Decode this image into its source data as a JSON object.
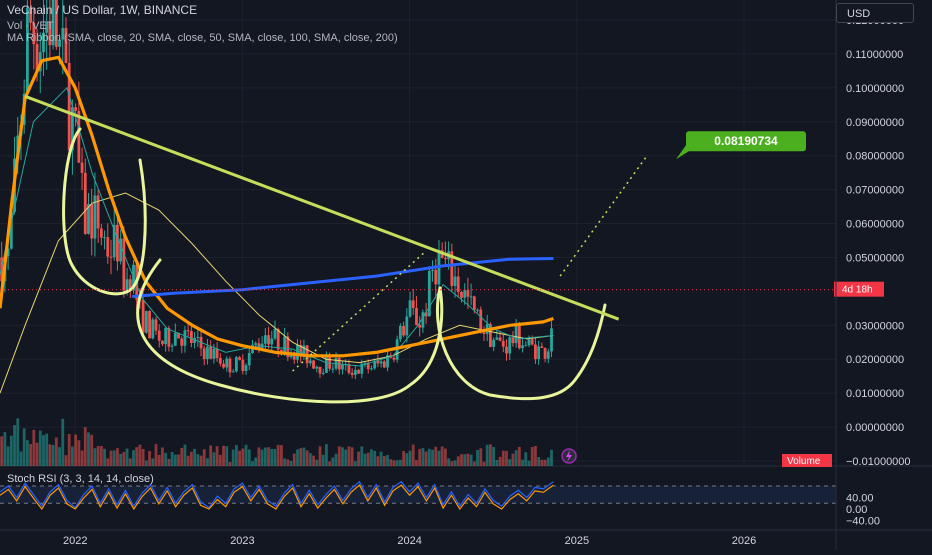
{
  "header": {
    "symbol_line": "VeChain / US Dollar, 1W, BINANCE",
    "vol_line": "Vol · VET",
    "ma_line": "MA Ribbon (SMA, close, 20, SMA, close, 50, SMA, close, 100, SMA, close, 200)"
  },
  "currency_button": "USD",
  "price_axis": {
    "labels": [
      "0.12000000",
      "0.11000000",
      "0.10000000",
      "0.09000000",
      "0.08000000",
      "0.07000000",
      "0.06000000",
      "0.05000000",
      "0.03000000",
      "0.02000000",
      "0.01000000",
      "0.00000000",
      "−0.01000000"
    ],
    "label_values": [
      0.12,
      0.11,
      0.1,
      0.09,
      0.08,
      0.07,
      0.06,
      0.05,
      0.03,
      0.02,
      0.01,
      0.0,
      -0.01
    ]
  },
  "current_price_tag": "4d 18h",
  "volume_tag": "Volume",
  "target_tag": "0.08190734",
  "time_axis": {
    "labels": [
      "2022",
      "2023",
      "2024",
      "2025",
      "2026"
    ],
    "values": [
      2022,
      2023,
      2024,
      2025,
      2026
    ]
  },
  "rsi_panel": {
    "title": "Stoch RSI (3, 3, 14, 14, close)",
    "labels": [
      "40.00",
      "0.00",
      "−40.00"
    ],
    "label_values": [
      40,
      0,
      -40
    ],
    "band_upper": 80,
    "band_lower": 20
  },
  "colors": {
    "background": "#131722",
    "up": "#26a69a",
    "down": "#ef5350",
    "ma20": "#26a69a",
    "ma50": "#e6d56e",
    "orange": "#ff9800",
    "blue": "#2962ff",
    "yellow_draw": "#e8f59a",
    "trendline": "#c5dd5a",
    "target_green": "#4caf1f",
    "price_tag_red": "#f23645",
    "rsi_k": "#2962ff",
    "rsi_d": "#ff9800"
  },
  "chart_data": {
    "type": "candlestick",
    "title": "VeChain / US Dollar, 1W, BINANCE",
    "x_range": [
      2021.55,
      2026.55
    ],
    "y_range": [
      -0.01,
      0.12
    ],
    "current_price": 0.0405,
    "target_price": 0.08190734,
    "close_anchors": [
      [
        2021.6,
        0.05
      ],
      [
        2021.68,
        0.095
      ],
      [
        2021.72,
        0.12
      ],
      [
        2021.78,
        0.115
      ],
      [
        2021.86,
        0.122
      ],
      [
        2021.93,
        0.104
      ],
      [
        2022.0,
        0.085
      ],
      [
        2022.05,
        0.062
      ],
      [
        2022.12,
        0.062
      ],
      [
        2022.2,
        0.052
      ],
      [
        2022.25,
        0.055
      ],
      [
        2022.3,
        0.042
      ],
      [
        2022.34,
        0.048
      ],
      [
        2022.38,
        0.034
      ],
      [
        2022.45,
        0.029
      ],
      [
        2022.52,
        0.025
      ],
      [
        2022.6,
        0.028
      ],
      [
        2022.68,
        0.026
      ],
      [
        2022.76,
        0.023
      ],
      [
        2022.84,
        0.021
      ],
      [
        2022.92,
        0.018
      ],
      [
        2023.0,
        0.019
      ],
      [
        2023.08,
        0.024
      ],
      [
        2023.14,
        0.028
      ],
      [
        2023.22,
        0.025
      ],
      [
        2023.3,
        0.023
      ],
      [
        2023.38,
        0.021
      ],
      [
        2023.46,
        0.018
      ],
      [
        2023.54,
        0.019
      ],
      [
        2023.62,
        0.017
      ],
      [
        2023.7,
        0.017
      ],
      [
        2023.78,
        0.018
      ],
      [
        2023.84,
        0.019
      ],
      [
        2023.9,
        0.022
      ],
      [
        2023.96,
        0.029
      ],
      [
        2024.0,
        0.034
      ],
      [
        2024.06,
        0.031
      ],
      [
        2024.1,
        0.036
      ],
      [
        2024.14,
        0.047
      ],
      [
        2024.18,
        0.05
      ],
      [
        2024.22,
        0.047
      ],
      [
        2024.28,
        0.043
      ],
      [
        2024.34,
        0.038
      ],
      [
        2024.4,
        0.032
      ],
      [
        2024.46,
        0.028
      ],
      [
        2024.52,
        0.025
      ],
      [
        2024.58,
        0.024
      ],
      [
        2024.64,
        0.027
      ],
      [
        2024.7,
        0.024
      ],
      [
        2024.76,
        0.023
      ],
      [
        2024.8,
        0.022
      ],
      [
        2024.84,
        0.025
      ],
      [
        2024.86,
        0.04
      ]
    ],
    "ma_orange": [
      [
        2021.55,
        0.035
      ],
      [
        2021.62,
        0.066
      ],
      [
        2021.7,
        0.097
      ],
      [
        2021.8,
        0.108
      ],
      [
        2021.9,
        0.109
      ],
      [
        2022.0,
        0.1
      ],
      [
        2022.1,
        0.086
      ],
      [
        2022.2,
        0.07
      ],
      [
        2022.3,
        0.056
      ],
      [
        2022.42,
        0.043
      ],
      [
        2022.55,
        0.035
      ],
      [
        2022.7,
        0.03
      ],
      [
        2022.85,
        0.026
      ],
      [
        2023.0,
        0.024
      ],
      [
        2023.2,
        0.022
      ],
      [
        2023.4,
        0.021
      ],
      [
        2023.6,
        0.021
      ],
      [
        2023.8,
        0.022
      ],
      [
        2024.0,
        0.024
      ],
      [
        2024.2,
        0.026
      ],
      [
        2024.4,
        0.028
      ],
      [
        2024.6,
        0.03
      ],
      [
        2024.8,
        0.031
      ],
      [
        2024.86,
        0.032
      ]
    ],
    "ma_blue": [
      [
        2022.34,
        0.0385
      ],
      [
        2022.6,
        0.0395
      ],
      [
        2023.0,
        0.0405
      ],
      [
        2023.4,
        0.0425
      ],
      [
        2023.8,
        0.0445
      ],
      [
        2024.2,
        0.0475
      ],
      [
        2024.6,
        0.0495
      ],
      [
        2024.86,
        0.0497
      ]
    ],
    "ma50": [
      [
        2021.55,
        0.01
      ],
      [
        2021.7,
        0.03
      ],
      [
        2021.9,
        0.055
      ],
      [
        2022.1,
        0.066
      ],
      [
        2022.3,
        0.069
      ],
      [
        2022.5,
        0.064
      ],
      [
        2022.7,
        0.054
      ],
      [
        2022.9,
        0.043
      ],
      [
        2023.1,
        0.033
      ],
      [
        2023.3,
        0.025
      ],
      [
        2023.5,
        0.02
      ],
      [
        2023.7,
        0.019
      ],
      [
        2023.9,
        0.021
      ],
      [
        2024.1,
        0.026
      ],
      [
        2024.3,
        0.03
      ],
      [
        2024.5,
        0.028
      ],
      [
        2024.7,
        0.026
      ],
      [
        2024.86,
        0.027
      ]
    ],
    "ma20": [
      [
        2021.55,
        0.045
      ],
      [
        2021.75,
        0.09
      ],
      [
        2021.95,
        0.1
      ],
      [
        2022.1,
        0.075
      ],
      [
        2022.25,
        0.056
      ],
      [
        2022.4,
        0.038
      ],
      [
        2022.55,
        0.029
      ],
      [
        2022.7,
        0.026
      ],
      [
        2022.9,
        0.022
      ],
      [
        2023.1,
        0.024
      ],
      [
        2023.3,
        0.023
      ],
      [
        2023.5,
        0.019
      ],
      [
        2023.7,
        0.018
      ],
      [
        2023.9,
        0.021
      ],
      [
        2024.05,
        0.03
      ],
      [
        2024.2,
        0.042
      ],
      [
        2024.35,
        0.036
      ],
      [
        2024.5,
        0.029
      ],
      [
        2024.65,
        0.026
      ],
      [
        2024.86,
        0.027
      ]
    ],
    "trendline": [
      [
        2021.7,
        0.0975
      ],
      [
        2025.25,
        0.0318
      ]
    ],
    "horizontal_level": 0.041,
    "projection": [
      [
        2024.9,
        0.0445
      ],
      [
        2025.42,
        0.08
      ]
    ],
    "dotted_connector": [
      [
        2023.3,
        0.0165
      ],
      [
        2024.1,
        0.052
      ]
    ],
    "rsi_series": [
      [
        2021.55,
        60
      ],
      [
        2021.6,
        80
      ],
      [
        2021.65,
        40
      ],
      [
        2021.7,
        90
      ],
      [
        2021.75,
        50
      ],
      [
        2021.8,
        10
      ],
      [
        2021.85,
        60
      ],
      [
        2021.9,
        85
      ],
      [
        2021.95,
        30
      ],
      [
        2022.0,
        5
      ],
      [
        2022.05,
        50
      ],
      [
        2022.1,
        80
      ],
      [
        2022.15,
        20
      ],
      [
        2022.2,
        70
      ],
      [
        2022.25,
        15
      ],
      [
        2022.3,
        65
      ],
      [
        2022.35,
        10
      ],
      [
        2022.4,
        55
      ],
      [
        2022.45,
        85
      ],
      [
        2022.5,
        30
      ],
      [
        2022.55,
        75
      ],
      [
        2022.6,
        20
      ],
      [
        2022.65,
        60
      ],
      [
        2022.7,
        85
      ],
      [
        2022.75,
        25
      ],
      [
        2022.8,
        5
      ],
      [
        2022.85,
        45
      ],
      [
        2022.9,
        20
      ],
      [
        2022.95,
        70
      ],
      [
        2023.0,
        90
      ],
      [
        2023.05,
        40
      ],
      [
        2023.1,
        80
      ],
      [
        2023.15,
        30
      ],
      [
        2023.2,
        10
      ],
      [
        2023.25,
        55
      ],
      [
        2023.3,
        85
      ],
      [
        2023.35,
        20
      ],
      [
        2023.4,
        65
      ],
      [
        2023.45,
        15
      ],
      [
        2023.5,
        50
      ],
      [
        2023.55,
        80
      ],
      [
        2023.6,
        30
      ],
      [
        2023.65,
        70
      ],
      [
        2023.7,
        95
      ],
      [
        2023.75,
        40
      ],
      [
        2023.8,
        85
      ],
      [
        2023.85,
        25
      ],
      [
        2023.9,
        75
      ],
      [
        2023.95,
        95
      ],
      [
        2024.0,
        60
      ],
      [
        2024.05,
        90
      ],
      [
        2024.1,
        40
      ],
      [
        2024.15,
        85
      ],
      [
        2024.2,
        15
      ],
      [
        2024.25,
        60
      ],
      [
        2024.3,
        10
      ],
      [
        2024.35,
        50
      ],
      [
        2024.4,
        20
      ],
      [
        2024.45,
        70
      ],
      [
        2024.5,
        30
      ],
      [
        2024.55,
        10
      ],
      [
        2024.6,
        45
      ],
      [
        2024.65,
        65
      ],
      [
        2024.7,
        40
      ],
      [
        2024.75,
        75
      ],
      [
        2024.8,
        70
      ],
      [
        2024.86,
        95
      ]
    ]
  }
}
